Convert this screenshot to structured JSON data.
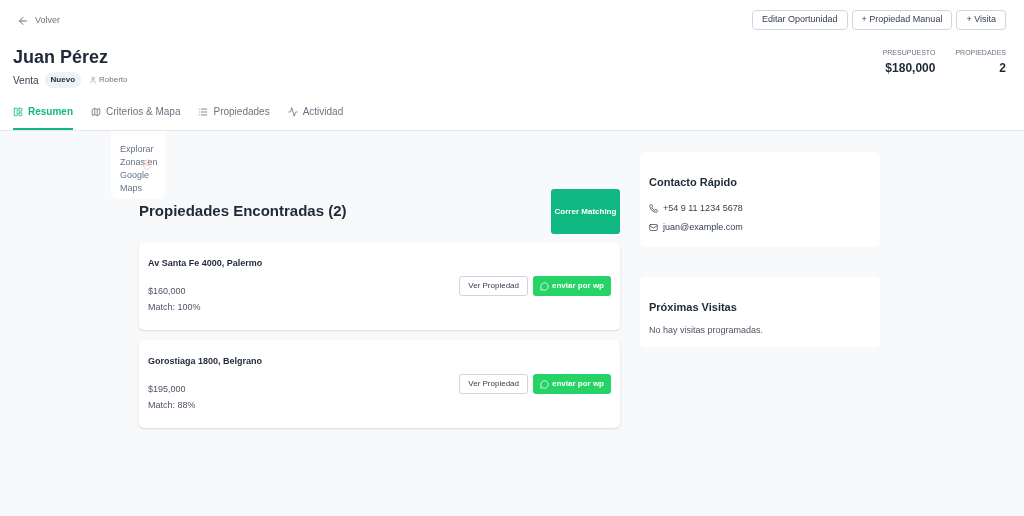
{
  "back_link": {
    "label": "Volver"
  },
  "header_actions": [
    "Editar Oportunidad",
    "+ Propiedad Manual",
    "+ Visita"
  ],
  "client": {
    "name": "Juan Pérez",
    "operation": "Venta",
    "status": "Nuevo",
    "agent": "Roberto"
  },
  "stats": [
    {
      "label": "PRESUPUESTO",
      "value": "$180,000"
    },
    {
      "label": "PROPIEDADES",
      "value": "2"
    }
  ],
  "tabs": [
    {
      "label": "Resumen",
      "selected": true
    },
    {
      "label": "Criterios & Mapa",
      "selected": false
    },
    {
      "label": "Propiedades",
      "selected": false
    },
    {
      "label": "Actividad",
      "selected": false
    }
  ],
  "explore_card": {
    "label": "Explorar Zonas en Google Maps"
  },
  "matches": {
    "title": "Propiedades Encontradas (2)",
    "run_button": "Correr Matching",
    "items": [
      {
        "address": "Av Santa Fe 4000, Palermo",
        "price": "$160,000",
        "match": "Match: 100%",
        "view_button": "Ver Propiedad",
        "send_button": "enviar por wp"
      },
      {
        "address": "Gorostiaga 1800, Belgrano",
        "price": "$195,000",
        "match": "Match: 88%",
        "view_button": "Ver Propiedad",
        "send_button": "enviar por wp"
      }
    ]
  },
  "contact": {
    "title": "Contacto Rápido",
    "phone": "+54 9 11 1234 5678",
    "email": "juan@example.com"
  },
  "visits": {
    "title": "Próximas Visitas",
    "empty": "No hay visitas programadas."
  }
}
